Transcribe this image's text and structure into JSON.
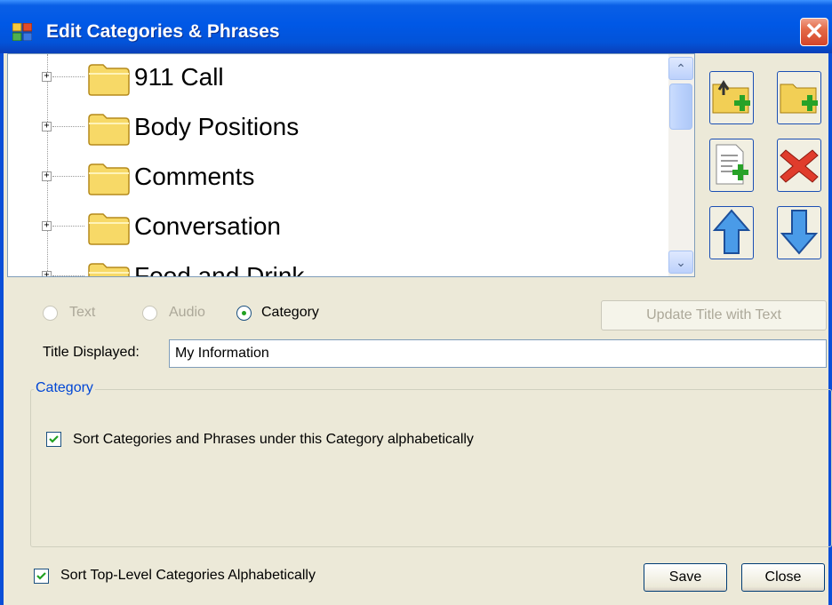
{
  "window": {
    "title": "Edit Categories & Phrases",
    "close_glyph": "✕"
  },
  "tree": {
    "expander_glyph": "+",
    "items": [
      {
        "label": "911 Call"
      },
      {
        "label": "Body Positions"
      },
      {
        "label": "Comments"
      },
      {
        "label": "Conversation"
      },
      {
        "label": "Food and Drink"
      }
    ]
  },
  "scrollbar": {
    "up_glyph": "⌃",
    "down_glyph": "⌄"
  },
  "toolbar": {
    "buttons": [
      {
        "icon": "add-subfolder-icon"
      },
      {
        "icon": "add-folder-icon"
      },
      {
        "icon": "add-phrase-icon"
      },
      {
        "icon": "delete-icon"
      },
      {
        "icon": "move-up-icon"
      },
      {
        "icon": "move-down-icon"
      }
    ]
  },
  "type_options": {
    "text": "Text",
    "audio": "Audio",
    "category": "Category",
    "selected": "category"
  },
  "update_title_button": "Update Title with Text",
  "title_field": {
    "label": "Title Displayed:",
    "value": "My Information"
  },
  "category_group": {
    "legend": "Category",
    "sort_checkbox": {
      "label": "Sort Categories and Phrases under this Category alphabetically",
      "checked": true
    }
  },
  "footer": {
    "sort_top_level": {
      "label": "Sort Top-Level Categories Alphabetically",
      "checked": true
    },
    "save_label": "Save",
    "close_label": "Close"
  },
  "colors": {
    "titlebar": "#0058e6",
    "accent_blue": "#0046d5",
    "background": "#ece9d8"
  }
}
